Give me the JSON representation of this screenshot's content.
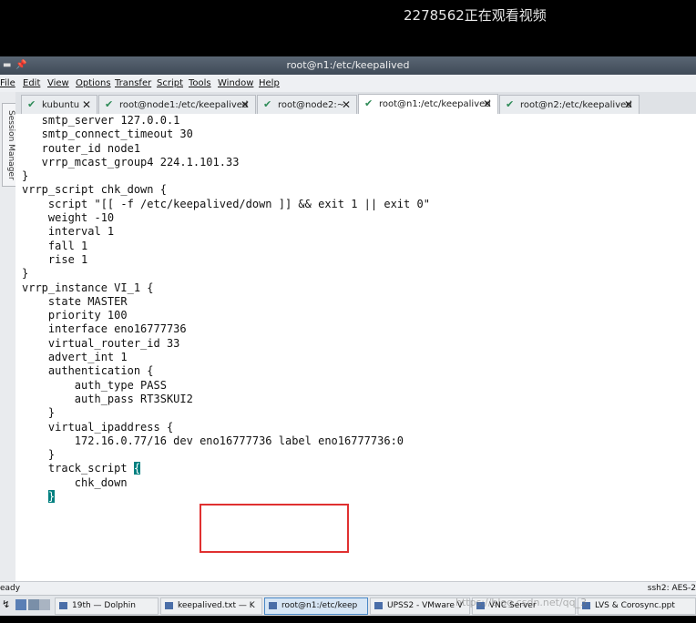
{
  "banner": {
    "text": "2278562正在观看视频"
  },
  "window": {
    "title": "root@n1:/etc/keepalived"
  },
  "menu": [
    "File",
    "Edit",
    "View",
    "Options",
    "Transfer",
    "Script",
    "Tools",
    "Window",
    "Help"
  ],
  "sidebar": {
    "label": "Session Manager"
  },
  "tabs": [
    {
      "label": "kubuntu",
      "active": false
    },
    {
      "label": "root@node1:/etc/keepalived",
      "active": false
    },
    {
      "label": "root@node2:~",
      "active": false
    },
    {
      "label": "root@n1:/etc/keepalived",
      "active": true
    },
    {
      "label": "root@n2:/etc/keepalived",
      "active": false
    }
  ],
  "terminal": {
    "lines": [
      "   smtp_server 127.0.0.1",
      "   smtp_connect_timeout 30",
      "   router_id node1",
      "   vrrp_mcast_group4 224.1.101.33",
      "}",
      "",
      "vrrp_script chk_down {",
      "    script \"[[ -f /etc/keepalived/down ]] && exit 1 || exit 0\"",
      "    weight -10",
      "    interval 1",
      "    fall 1",
      "    rise 1",
      "}",
      "",
      "vrrp_instance VI_1 {",
      "    state MASTER",
      "    priority 100",
      "    interface eno16777736",
      "    virtual_router_id 33",
      "    advert_int 1",
      "    authentication {",
      "        auth_type PASS",
      "        auth_pass RT3SKUI2",
      "    }",
      "    virtual_ipaddress {",
      "        172.16.0.77/16 dev eno16777736 label eno16777736:0",
      "    }",
      "",
      "    track_script {",
      "        chk_down",
      "    }"
    ]
  },
  "status": {
    "left": "eady",
    "right": "ssh2: AES-2"
  },
  "taskbar": {
    "items": [
      {
        "label": "19th — Dolphin"
      },
      {
        "label": "keepalived.txt — K"
      },
      {
        "label": "root@n1:/etc/keep"
      },
      {
        "label": "UPSS2 - VMware V"
      },
      {
        "label": "VNC Server"
      },
      {
        "label": "LVS & Corosync.ppt"
      }
    ],
    "watermark": "https://blog.csdn.net/qq_3"
  },
  "colors": {
    "cursor": "#008080",
    "highlight_box": "#e03030"
  }
}
